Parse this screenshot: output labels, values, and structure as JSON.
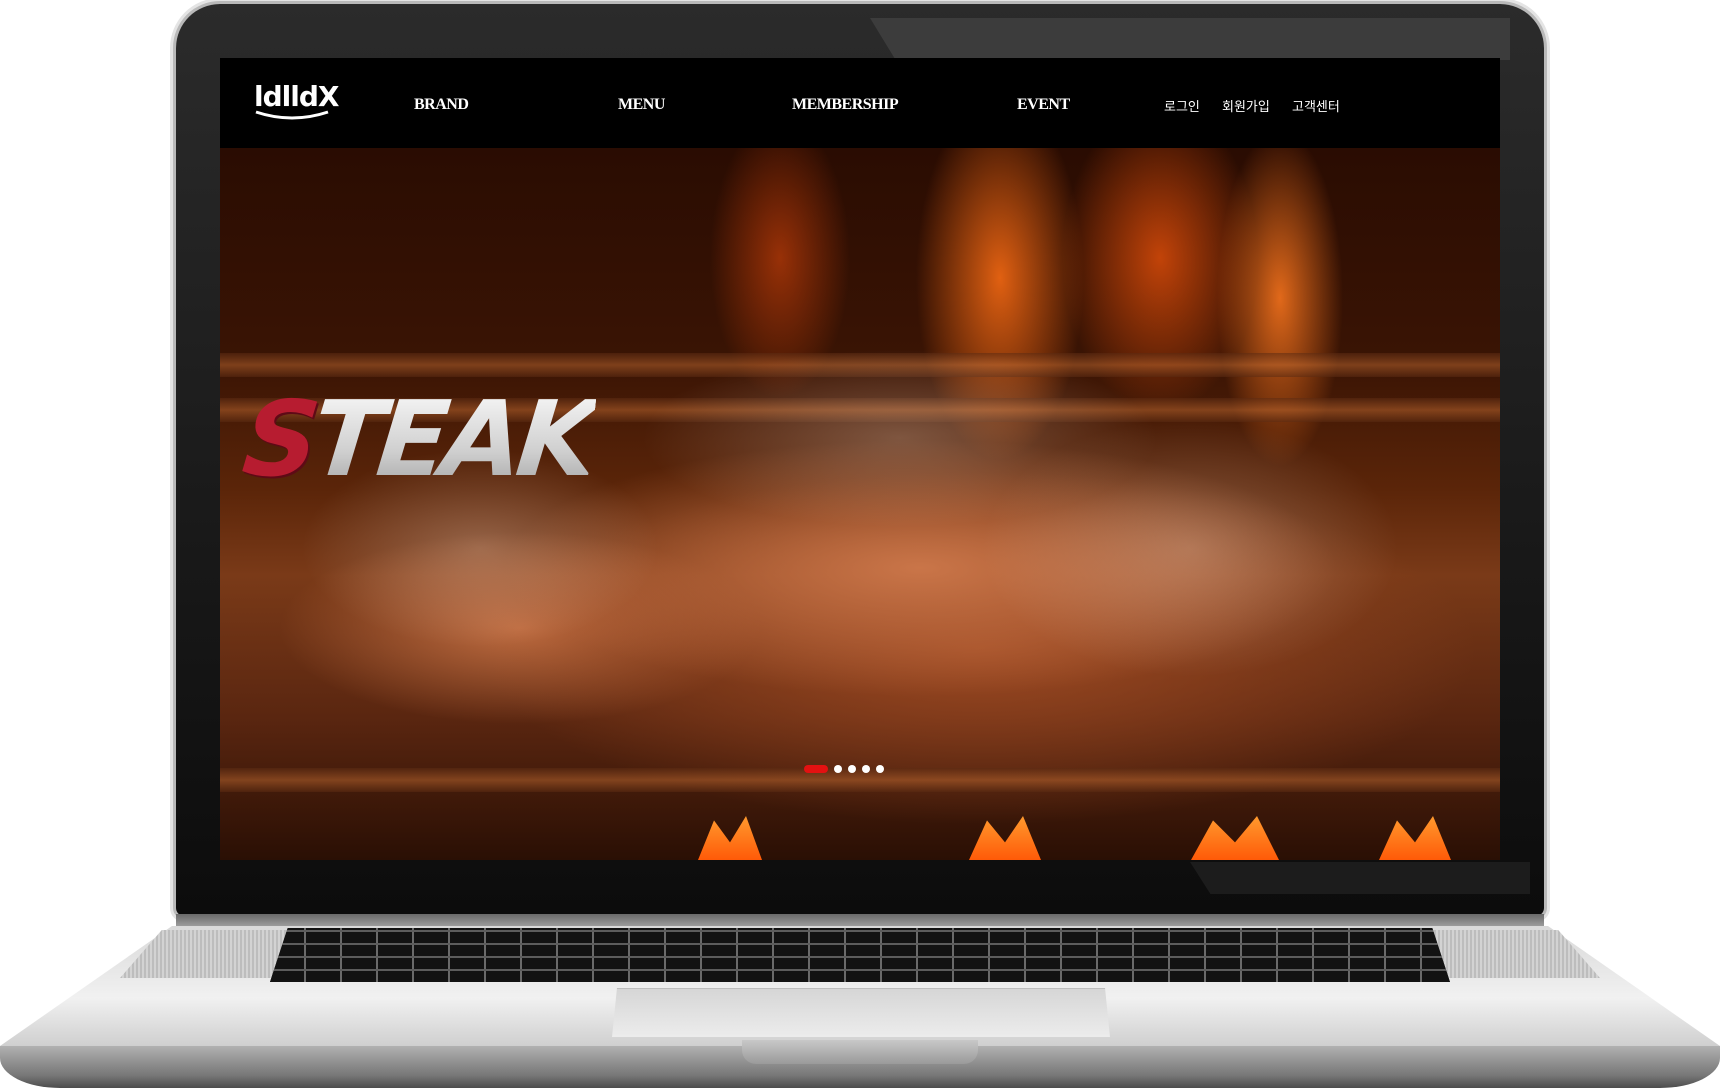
{
  "brand": {
    "logo_text": "ldlldX"
  },
  "nav": {
    "items": [
      {
        "label": "BRAND"
      },
      {
        "label": "MENU"
      },
      {
        "label": "MEMBERSHIP"
      },
      {
        "label": "EVENT"
      }
    ],
    "utility": {
      "login": "로그인",
      "signup": "회원가입",
      "support": "고객센터"
    }
  },
  "hero": {
    "headline_first": "S",
    "headline_rest": "TEAK",
    "accent_color": "#b71c30",
    "slides_total": 5,
    "active_slide": 1
  },
  "colors": {
    "nav_background": "#000000",
    "pager_active": "#e31111",
    "pager_inactive": "#ffffff"
  }
}
